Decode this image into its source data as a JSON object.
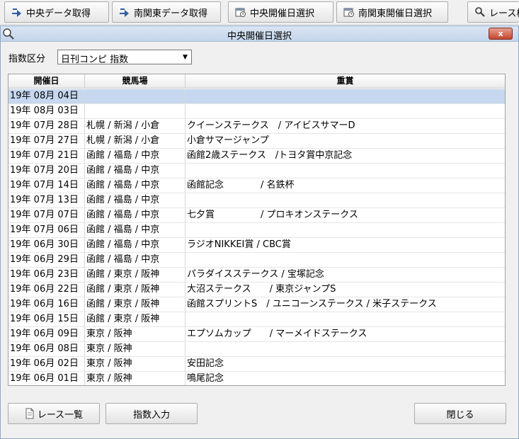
{
  "toolbar": {
    "buttons": [
      {
        "label": "中央データ取得",
        "icon": "arrow-download-icon"
      },
      {
        "label": "南関東データ取得",
        "icon": "arrow-download-icon"
      },
      {
        "label": "中央開催日選択",
        "icon": "calendar-icon"
      },
      {
        "label": "南関東開催日選択",
        "icon": "calendar-icon"
      },
      {
        "label": "レース検",
        "icon": "search-icon"
      }
    ]
  },
  "dialog": {
    "title": "中央開催日選択",
    "close_label": "x",
    "filter_label": "指数区分",
    "filter_value": "日刊コンピ 指数"
  },
  "table": {
    "headers": [
      "開催日",
      "競馬場",
      "重賞"
    ],
    "rows": [
      [
        "19年 08月 04日",
        "",
        ""
      ],
      [
        "19年 08月 03日",
        "",
        ""
      ],
      [
        "19年 07月 28日",
        "札幌 / 新潟 / 小倉",
        "クイーンステークス　/ アイビスサマーD"
      ],
      [
        "19年 07月 27日",
        "札幌 / 新潟 / 小倉",
        "小倉サマージャンプ"
      ],
      [
        "19年 07月 21日",
        "函館 / 福島 / 中京",
        "函館2歳ステークス　/トヨタ賞中京記念"
      ],
      [
        "19年 07月 20日",
        "函館 / 福島 / 中京",
        ""
      ],
      [
        "19年 07月 14日",
        "函館 / 福島 / 中京",
        "函館記念　　　　/ 名鉄杯"
      ],
      [
        "19年 07月 13日",
        "函館 / 福島 / 中京",
        ""
      ],
      [
        "19年 07月 07日",
        "函館 / 福島 / 中京",
        "七夕賞　　　　　/ プロキオンステークス"
      ],
      [
        "19年 07月 06日",
        "函館 / 福島 / 中京",
        ""
      ],
      [
        "19年 06月 30日",
        "函館 / 福島 / 中京",
        "ラジオNIKKEI賞 / CBC賞"
      ],
      [
        "19年 06月 29日",
        "函館 / 福島 / 中京",
        ""
      ],
      [
        "19年 06月 23日",
        "函館 / 東京 / 阪神",
        "パラダイスステークス / 宝塚記念"
      ],
      [
        "19年 06月 22日",
        "函館 / 東京 / 阪神",
        "大沼ステークス　　/ 東京ジャンプS"
      ],
      [
        "19年 06月 16日",
        "函館 / 東京 / 阪神",
        "函館スプリントS　/ ユニコーンステークス / 米子ステークス"
      ],
      [
        "19年 06月 15日",
        "函館 / 東京 / 阪神",
        ""
      ],
      [
        "19年 06月 09日",
        "東京 / 阪神",
        "エプソムカップ　　/ マーメイドステークス"
      ],
      [
        "19年 06月 08日",
        "東京 / 阪神",
        ""
      ],
      [
        "19年 06月 02日",
        "東京 / 阪神",
        "安田記念"
      ],
      [
        "19年 06月 01日",
        "東京 / 阪神",
        "鳴尾記念"
      ]
    ],
    "selected_row": 0
  },
  "footer": {
    "race_list_label": "レース一覧",
    "index_input_label": "指数入力",
    "close_label": "閉じる"
  }
}
